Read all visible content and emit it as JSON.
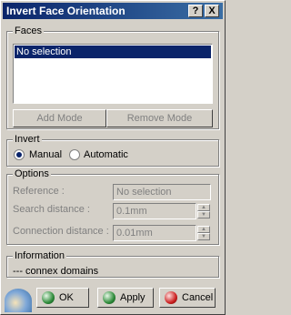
{
  "window": {
    "title": "Invert Face Orientation",
    "help_label": "?",
    "close_label": "X"
  },
  "faces": {
    "label": "Faces",
    "items": [
      "No selection"
    ],
    "add_mode_label": "Add Mode",
    "remove_mode_label": "Remove Mode"
  },
  "invert": {
    "label": "Invert",
    "manual_label": "Manual",
    "automatic_label": "Automatic",
    "selected": "Manual"
  },
  "options": {
    "label": "Options",
    "reference_label": "Reference :",
    "reference_value": "No selection",
    "search_label": "Search distance :",
    "search_value": "0.1mm",
    "connection_label": "Connection distance :",
    "connection_value": "0.01mm"
  },
  "information": {
    "label": "Information",
    "text": "--- connex domains"
  },
  "buttons": {
    "ok": "OK",
    "apply": "Apply",
    "cancel": "Cancel"
  },
  "colors": {
    "title_bar": "#0a246a",
    "ok_icon": "#2e8b3a",
    "apply_icon": "#2e8b3a",
    "cancel_icon": "#cc2020"
  }
}
